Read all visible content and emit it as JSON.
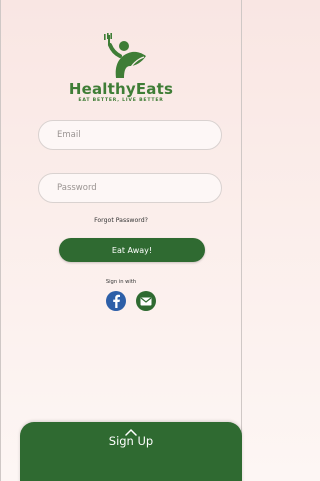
{
  "brand": {
    "name": "HealthyEats",
    "tagline": "EAT BETTER, LIVE BETTER"
  },
  "form": {
    "email_placeholder": "Email",
    "password_placeholder": "Password",
    "forgot_label": "Forgot Password?",
    "submit_label": "Eat Away!"
  },
  "social": {
    "caption": "Sign in with",
    "providers": [
      "facebook",
      "email"
    ],
    "icons": [
      "facebook-icon",
      "mail-icon"
    ]
  },
  "footer": {
    "signup_label": "Sign Up",
    "icon": "chevron-up-icon"
  },
  "colors": {
    "brand_green": "#3f7d36",
    "button_green": "#2f6a31",
    "facebook_blue": "#2d5fa8",
    "background_top": "#f9e6e3"
  }
}
